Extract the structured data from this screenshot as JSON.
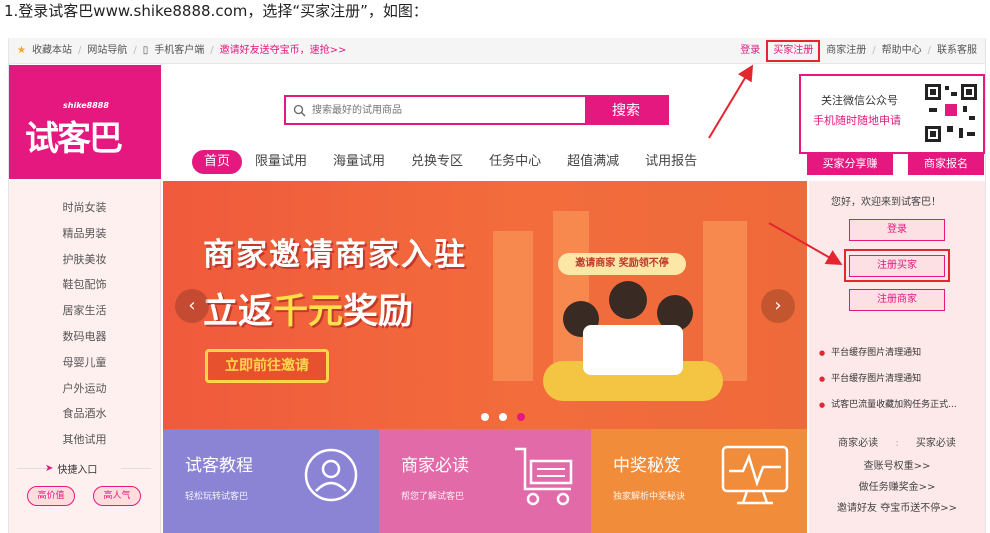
{
  "caption": "1.登录试客巴www.shike8888.com，选择“买家注册”，如图：",
  "topbar": {
    "left": [
      "收藏本站",
      "网站导航",
      "手机客户端",
      "邀请好友送夺宝币，速抢>>"
    ],
    "right": [
      "登录",
      "买家注册",
      "商家注册",
      "帮助中心",
      "联系客服"
    ]
  },
  "logo": {
    "small": "shike8888",
    "big": "试客巴"
  },
  "search": {
    "placeholder": "搜索最好的试用商品",
    "button": "搜索"
  },
  "nav": [
    "首页",
    "限量试用",
    "海量试用",
    "兑换专区",
    "任务中心",
    "超值满减",
    "试用报告"
  ],
  "qr": {
    "line1": "关注微信公众号",
    "line2": "手机随时随地申请"
  },
  "header_buttons": {
    "share": "买家分享赚",
    "merchant": "商家报名"
  },
  "categories": [
    "时尚女装",
    "精品男装",
    "护肤美妆",
    "鞋包配饰",
    "居家生活",
    "数码电器",
    "母婴儿童",
    "户外运动",
    "食品酒水",
    "其他试用"
  ],
  "quick_entry": {
    "label": "快捷入口",
    "pills": [
      "高价值",
      "高人气"
    ]
  },
  "banner": {
    "line1": "商家邀请商家入驻",
    "line2_prefix": "立返",
    "line2_highlight": "千元",
    "line2_suffix": "奖励",
    "button": "立即前往邀请",
    "ribbon": "邀请商家 奖励领不停"
  },
  "tiles": [
    {
      "title": "试客教程",
      "subtitle": "轻松玩转试客巴"
    },
    {
      "title": "商家必读",
      "subtitle": "帮您了解试客巴"
    },
    {
      "title": "中奖秘笈",
      "subtitle": "独家解析中奖秘诀"
    }
  ],
  "right_panel": {
    "welcome": "您好，欢迎来到试客巴！",
    "buttons": [
      "登录",
      "注册买家",
      "注册商家"
    ],
    "news": [
      "平台缓存图片清理通知",
      "平台缓存图片清理通知",
      "试客巴流量收藏加购任务正式..."
    ],
    "tabs": [
      "商家必读",
      "买家必读"
    ],
    "links": [
      "查账号权重>>",
      "做任务赚奖金>>",
      "邀请好友 夺宝币送不停>>"
    ]
  }
}
